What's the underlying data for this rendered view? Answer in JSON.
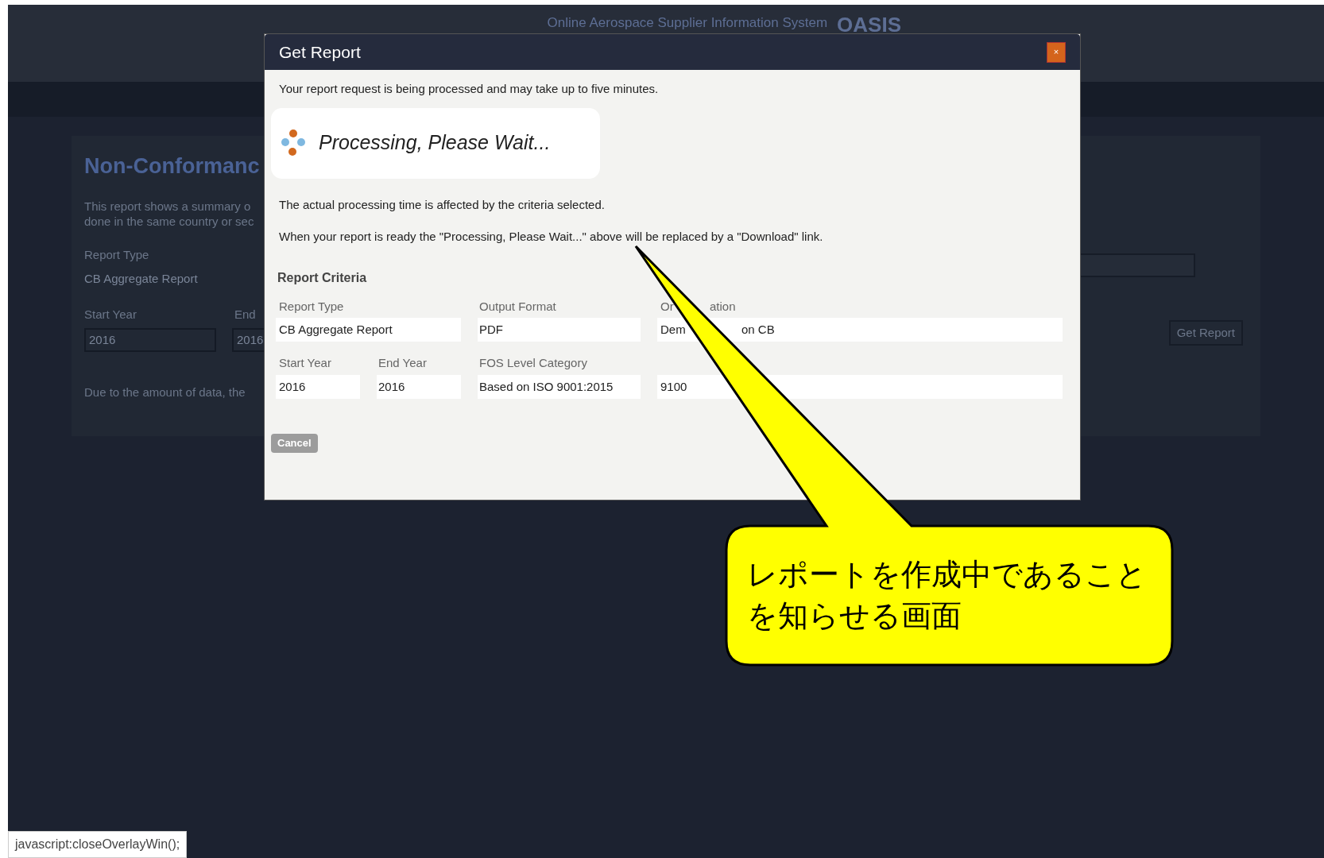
{
  "page": {
    "header_title": "Online Aerospace Supplier Information System",
    "brand": "OASIS",
    "heading": "Non-Conformanc",
    "description_lines": [
      "This report shows a summary o",
      "done in the same country or sec"
    ],
    "report_type_label": "Report Type",
    "report_type_value": "CB Aggregate Report",
    "start_year_label": "Start Year",
    "end_year_label": "End",
    "start_year_value": "2016",
    "end_year_value": "2016",
    "note": "Due to the amount of data, the",
    "get_report_button": "Get Report"
  },
  "dialog": {
    "title": "Get Report",
    "close": "×",
    "intro": "Your report request is being processed and may take up to five minutes.",
    "processing": "Processing, Please Wait...",
    "info_lines": [
      "The actual processing time is affected by the criteria selected.",
      "When your report is ready the \"Processing, Please Wait...\" above will be replaced by a \"Download\" link."
    ],
    "criteria_heading": "Report Criteria",
    "report_type": {
      "label": "Report Type",
      "value": "CB Aggregate Report"
    },
    "output_format": {
      "label": "Output Format",
      "value": "PDF"
    },
    "organization": {
      "label_parts": [
        "Or",
        "ation"
      ],
      "value_parts": [
        "Dem",
        "on CB"
      ]
    },
    "start_year": {
      "label": "Start Year",
      "value": "2016"
    },
    "end_year": {
      "label": "End Year",
      "value": "2016"
    },
    "fos_level": {
      "label": "FOS Level Category",
      "value": "Based on ISO 9001:2015"
    },
    "fos_code": {
      "value": "9100"
    },
    "cancel": "Cancel"
  },
  "callout": {
    "text": "レポートを作成中であることを知らせる画面"
  },
  "status_bar": {
    "url": "javascript:closeOverlayWin();"
  }
}
